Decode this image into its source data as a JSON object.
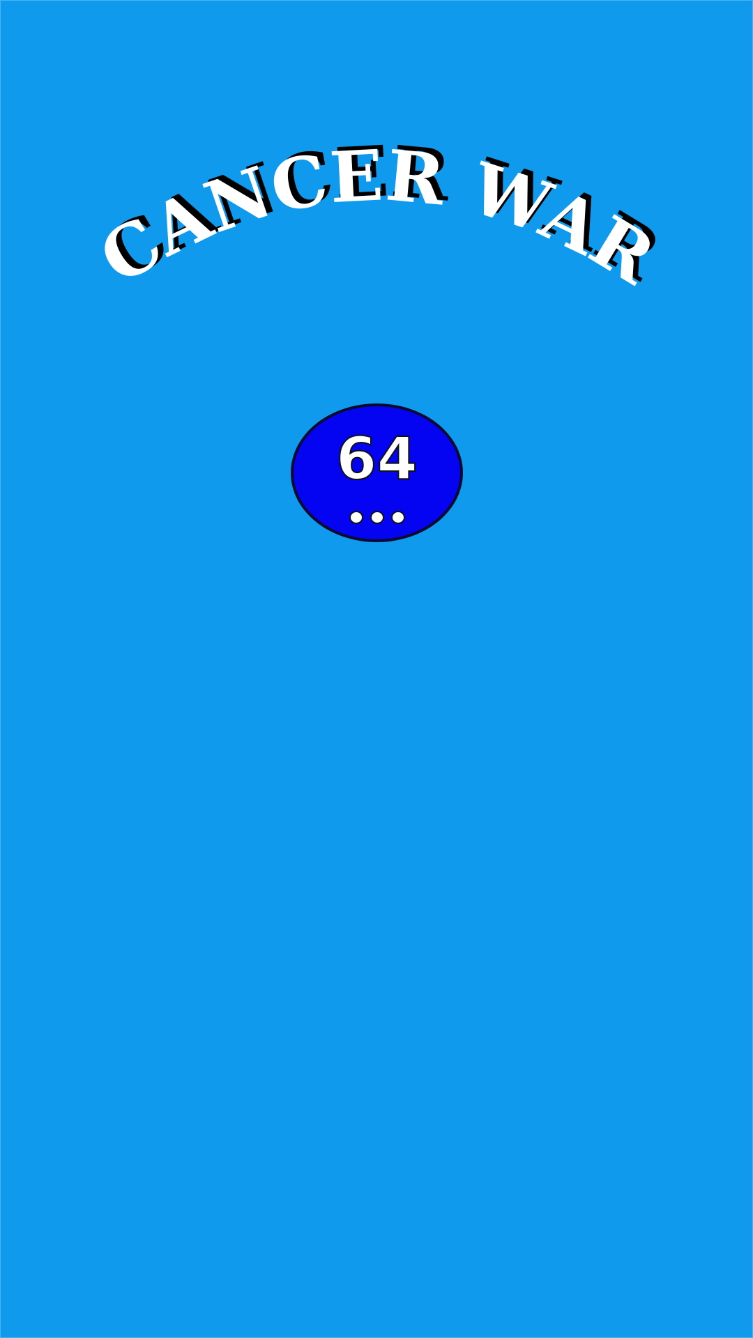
{
  "game": {
    "title": "CANCER WAR",
    "level_number": "64",
    "loading_dots": 3
  },
  "colors": {
    "background": "#109aed",
    "title_fill": "#ffffff",
    "title_shadow": "#000000",
    "badge_fill": "#0404f2",
    "badge_border": "#0a0a2e"
  }
}
